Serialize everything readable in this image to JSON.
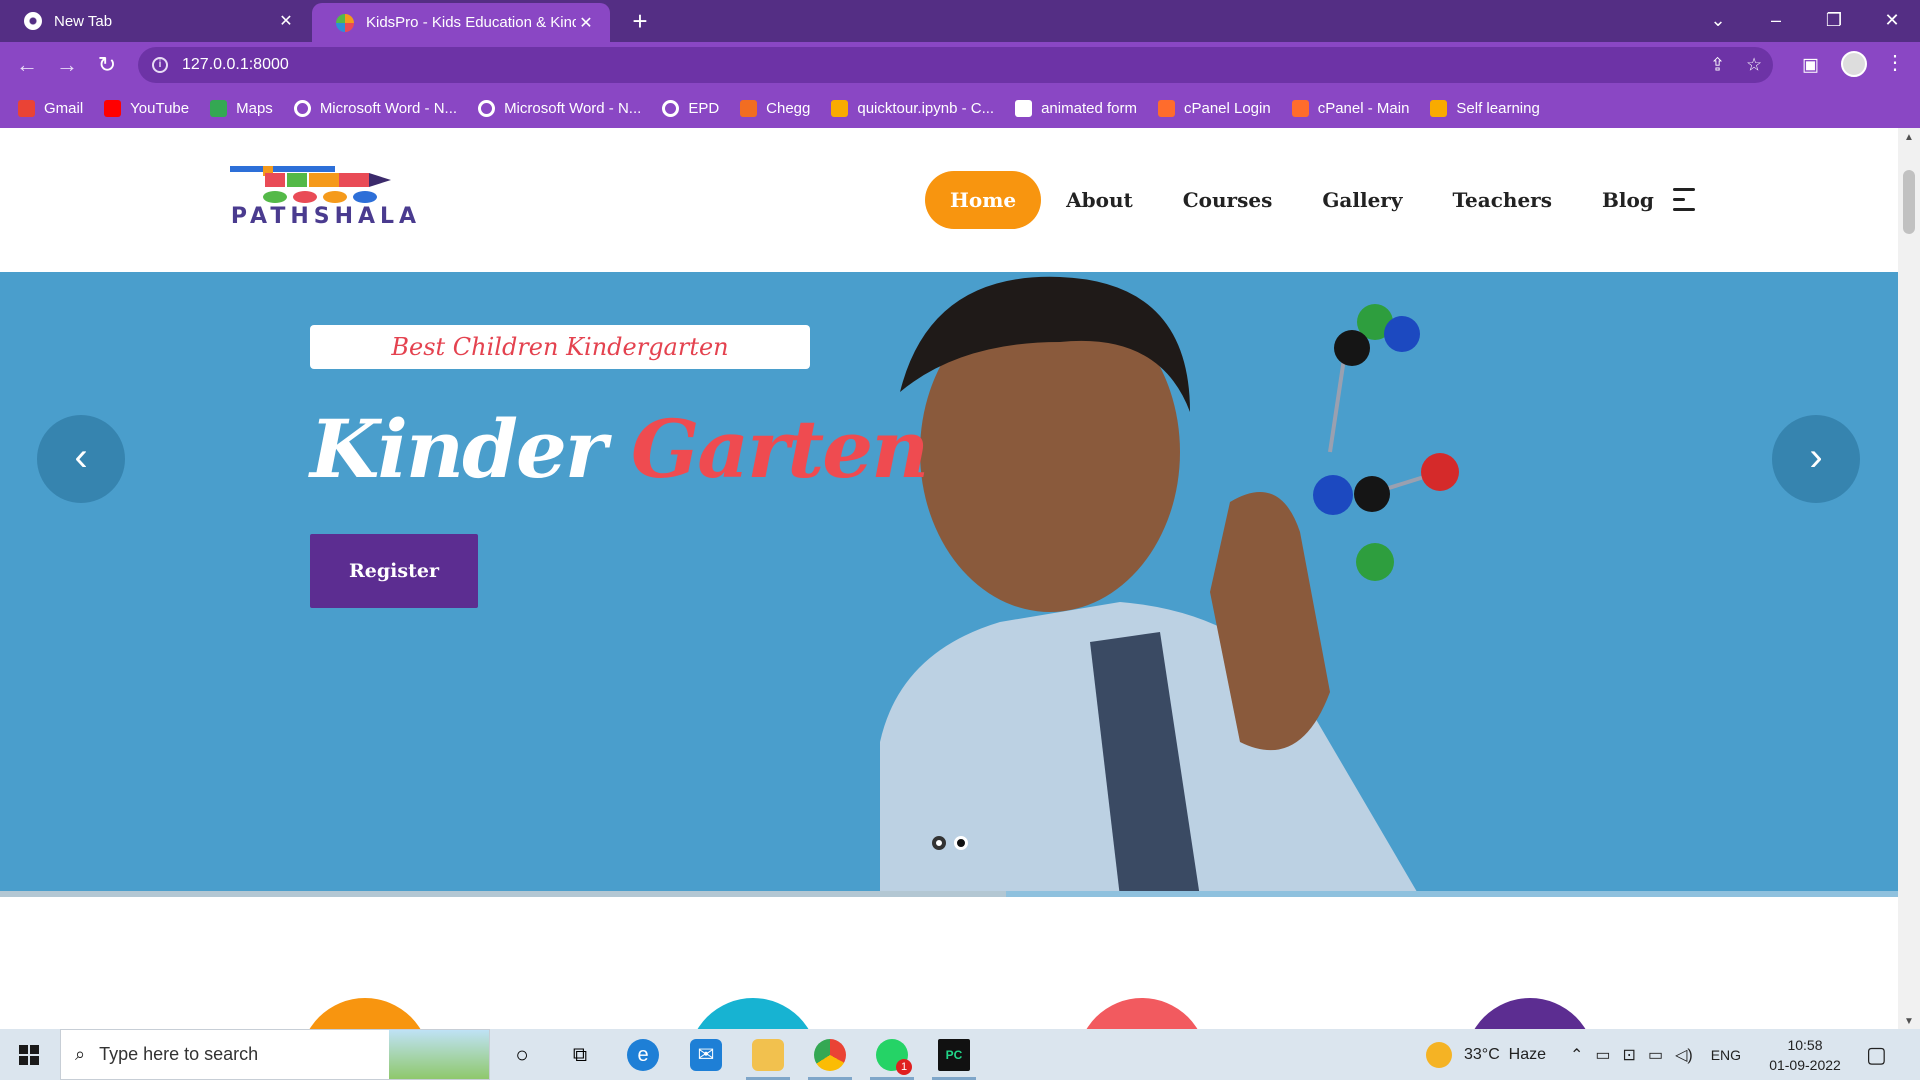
{
  "browser": {
    "tabs": [
      {
        "title": "New Tab",
        "active": false
      },
      {
        "title": "KidsPro - Kids Education & Kinde",
        "active": true
      }
    ],
    "url": "127.0.0.1:8000",
    "bookmarks": [
      {
        "label": "Gmail",
        "icon": "gmail-icon",
        "color": "#ea4335"
      },
      {
        "label": "YouTube",
        "icon": "youtube-icon",
        "color": "#ff0000"
      },
      {
        "label": "Maps",
        "icon": "maps-icon",
        "color": "#34a853"
      },
      {
        "label": "Microsoft Word - N...",
        "icon": "globe-icon",
        "color": "#ffffff"
      },
      {
        "label": "Microsoft Word - N...",
        "icon": "globe-icon",
        "color": "#ffffff"
      },
      {
        "label": "EPD",
        "icon": "globe-icon",
        "color": "#ffffff"
      },
      {
        "label": "Chegg",
        "icon": "chegg-icon",
        "color": "#f26d21"
      },
      {
        "label": "quicktour.ipynb - C...",
        "icon": "colab-icon",
        "color": "#f9ab00"
      },
      {
        "label": "animated form",
        "icon": "codepen-icon",
        "color": "#ffffff"
      },
      {
        "label": "cPanel Login",
        "icon": "cpanel-icon",
        "color": "#ff6c2c"
      },
      {
        "label": "cPanel - Main",
        "icon": "cpanel-icon",
        "color": "#ff6c2c"
      },
      {
        "label": "Self learning",
        "icon": "analytics-icon",
        "color": "#f9ab00"
      }
    ]
  },
  "site": {
    "logo_text": "PATHSHALA",
    "nav": [
      "Home",
      "About",
      "Courses",
      "Gallery",
      "Teachers",
      "Blog"
    ],
    "active_nav": "Home",
    "colors": {
      "accent": "#f8950f",
      "hero_bg": "#4a9ecc",
      "purple": "#5c2d91",
      "red": "#ef4b50"
    }
  },
  "hero": {
    "tagline": "Best Children Kindergarten",
    "title_part1": "Kinder",
    "title_part2": "Garten",
    "cta": "Register",
    "prev_icon": "‹",
    "next_icon": "›",
    "slides": 2,
    "active_slide": 2,
    "autoplay_progress": 0.53
  },
  "feature_circles": [
    {
      "color": "#f8950f"
    },
    {
      "color": "#17b3d2"
    },
    {
      "color": "#f25a5f"
    },
    {
      "color": "#5c2d91"
    }
  ],
  "taskbar": {
    "search_placeholder": "Type here to search",
    "weather": "33°C  Haze",
    "language": "ENG",
    "time": "10:58",
    "date": "01-09-2022",
    "whatsapp_badge": "1"
  }
}
